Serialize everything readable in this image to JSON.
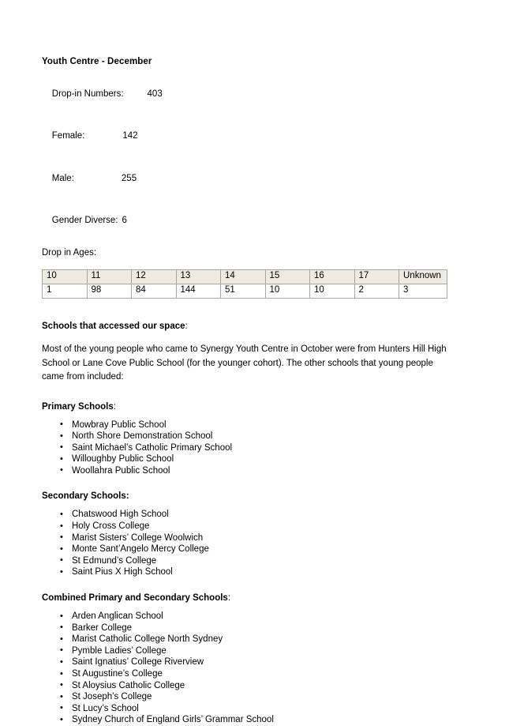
{
  "document": {
    "title": "Youth Centre - December",
    "stats": [
      {
        "label": "Drop-in Numbers:",
        "value": "403"
      },
      {
        "label": "Female:",
        "value": "142"
      },
      {
        "label": "Male:",
        "value": "255"
      },
      {
        "label": "Gender Diverse:",
        "value": "6"
      }
    ],
    "ages_label": "Drop in Ages:",
    "ages_table": {
      "headers": [
        "10",
        "11",
        "12",
        "13",
        "14",
        "15",
        "16",
        "17",
        "Unknown"
      ],
      "values": [
        "1",
        "98",
        "84",
        "144",
        "51",
        "10",
        "10",
        "2",
        "3"
      ]
    },
    "schools_heading": "Schools that accessed our space",
    "schools_heading_colon": ":",
    "intro_paragraph": "Most of the young people who came to Synergy Youth Centre in October were from Hunters Hill High School or Lane Cove Public School (for the younger cohort). The other schools that young people came from included:",
    "primary": {
      "heading": "Primary Schools",
      "heading_colon": ":",
      "items": [
        "Mowbray Public School",
        "North Shore Demonstration School",
        "Saint Michael’s Catholic Primary School",
        "Willoughby Public School",
        "Woollahra Public School"
      ]
    },
    "secondary": {
      "heading": "Secondary Schools:",
      "heading_colon": "",
      "items": [
        "Chatswood High School",
        "Holy Cross College",
        "Marist Sisters’ College Woolwich",
        "Monte Sant’Angelo Mercy College",
        "St Edmund’s College",
        "Saint Pius X High School"
      ]
    },
    "combined": {
      "heading": "Combined Primary and Secondary Schools",
      "heading_colon": ":",
      "items": [
        "Arden Anglican School",
        "Barker College",
        "Marist Catholic College North Sydney",
        "Pymble Ladies’ College",
        "Saint Ignatius’ College Riverview",
        "St Augustine’s College",
        "St Aloysius Catholic College",
        "St Joseph’s College",
        "St Lucy’s School",
        "Sydney Church of England Girls’ Grammar School"
      ]
    }
  },
  "colors": {
    "page_background": "#ffffff",
    "table_header_background": "#edece2",
    "table_border": "#a6a6a6",
    "text": "#000000"
  }
}
